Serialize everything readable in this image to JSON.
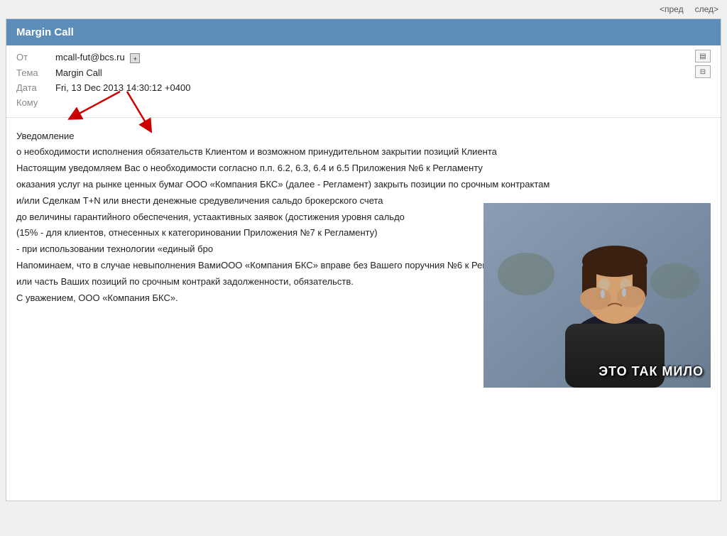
{
  "nav": {
    "prev_label": "<пред",
    "next_label": "след>"
  },
  "email": {
    "title": "Margin Call",
    "fields": {
      "from_label": "От",
      "from_value": "mcall-fut@bcs.ru",
      "subject_label": "Тема",
      "subject_value": "Margin Call",
      "date_label": "Дата",
      "date_value": "Fri, 13 Dec 2013 14:30:12 +0400",
      "to_label": "Кому",
      "to_value": ""
    },
    "body_lines": [
      "Уведомление",
      "о необходимости исполнения обязательств Клиентом и возможном принудительном закрытии позиций Клиента",
      "Настоящим уведомляем Вас о необходимости согласно п.п. 6.2, 6.3, 6.4 и 6.5 Приложения №6 к Регламенту",
      "оказания услуг на рынке ценных бумаг ООО «Компания БКС» (далее - Регламент) закрыть позиции по срочным контрактам",
      "и/или Сделкам T+N или внести денежные сред...  увеличения сальдо брокерского счета",
      "до величины гарантийного обеспечения, уста...  активных заявок (достижения уровня сальдо",
      "(15% - для клиентов, отнесенных к категори...  новании Приложения №7 к Регламенту)",
      "- при использовании технологии «единый бро...",
      "Напоминаем, что в случае невыполнения Вами... ООО «Компания БКС» вправе без Вашего поруч...  ния №6 к Регламенту закрыть все",
      "или часть Ваших позиций по срочным контрак...  й задолженности, обязательств.",
      "С уважением, ООО «Компания БКС»."
    ],
    "meme_caption": "ЭТО ТАК МИЛО"
  }
}
